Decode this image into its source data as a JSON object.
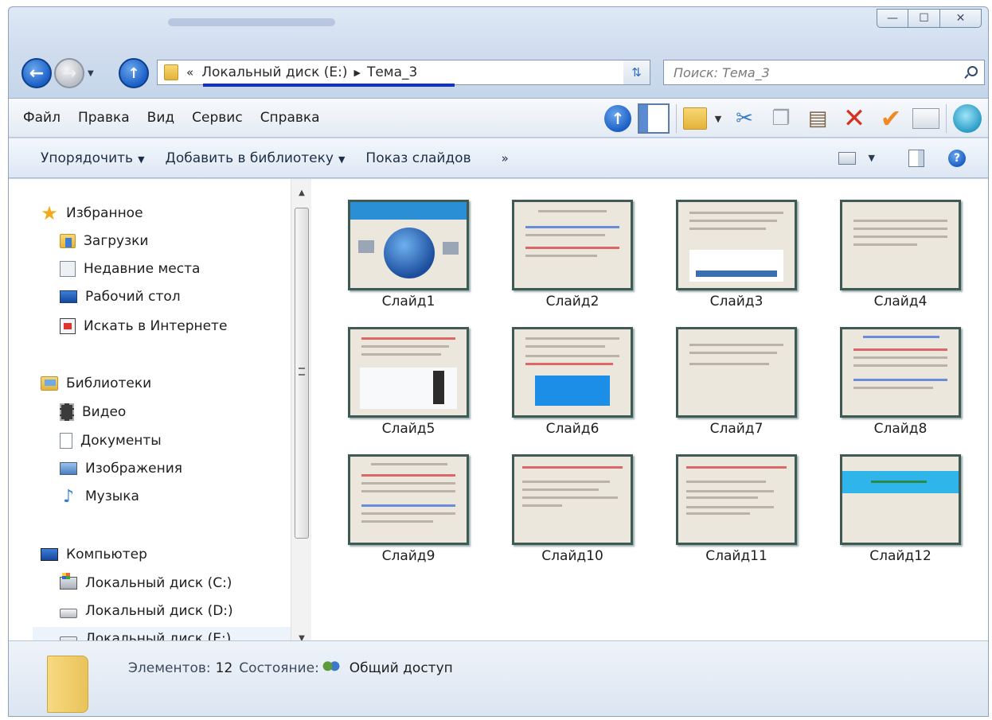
{
  "window": {
    "caption_minimize": "—",
    "caption_maximize": "☐",
    "caption_close": "✕"
  },
  "address": {
    "overflow": "«",
    "crumbs": [
      "Локальный диск (E:)",
      "Тема_3"
    ]
  },
  "search": {
    "placeholder": "Поиск: Тема_3"
  },
  "menu": [
    "Файл",
    "Правка",
    "Вид",
    "Сервис",
    "Справка"
  ],
  "commands": {
    "organize": "Упорядочить",
    "add_to_library": "Добавить в библиотеку",
    "slideshow": "Показ слайдов",
    "more": "»"
  },
  "nav": {
    "favorites": "Избранное",
    "downloads": "Загрузки",
    "recent": "Недавние места",
    "desktop": "Рабочий стол",
    "search_web": "Искать в Интернете",
    "libraries": "Библиотеки",
    "video": "Видео",
    "documents": "Документы",
    "images": "Изображения",
    "music": "Музыка",
    "computer": "Компьютер",
    "disk_c": "Локальный диск (C:)",
    "disk_d": "Локальный диск (D:)",
    "disk_e": "Локальный диск (E:)"
  },
  "files": [
    {
      "name": "Слайд1"
    },
    {
      "name": "Слайд2"
    },
    {
      "name": "Слайд3"
    },
    {
      "name": "Слайд4"
    },
    {
      "name": "Слайд5"
    },
    {
      "name": "Слайд6"
    },
    {
      "name": "Слайд7"
    },
    {
      "name": "Слайд8"
    },
    {
      "name": "Слайд9"
    },
    {
      "name": "Слайд10"
    },
    {
      "name": "Слайд11"
    },
    {
      "name": "Слайд12"
    }
  ],
  "details": {
    "items_label": "Элементов:",
    "items_count": "12",
    "state_label": "Состояние:",
    "state_value": "Общий доступ"
  },
  "colors": {
    "accent_underline": "#1032c8",
    "slide_border": "#3f5a54",
    "slide_bg": "#ece7dd"
  }
}
